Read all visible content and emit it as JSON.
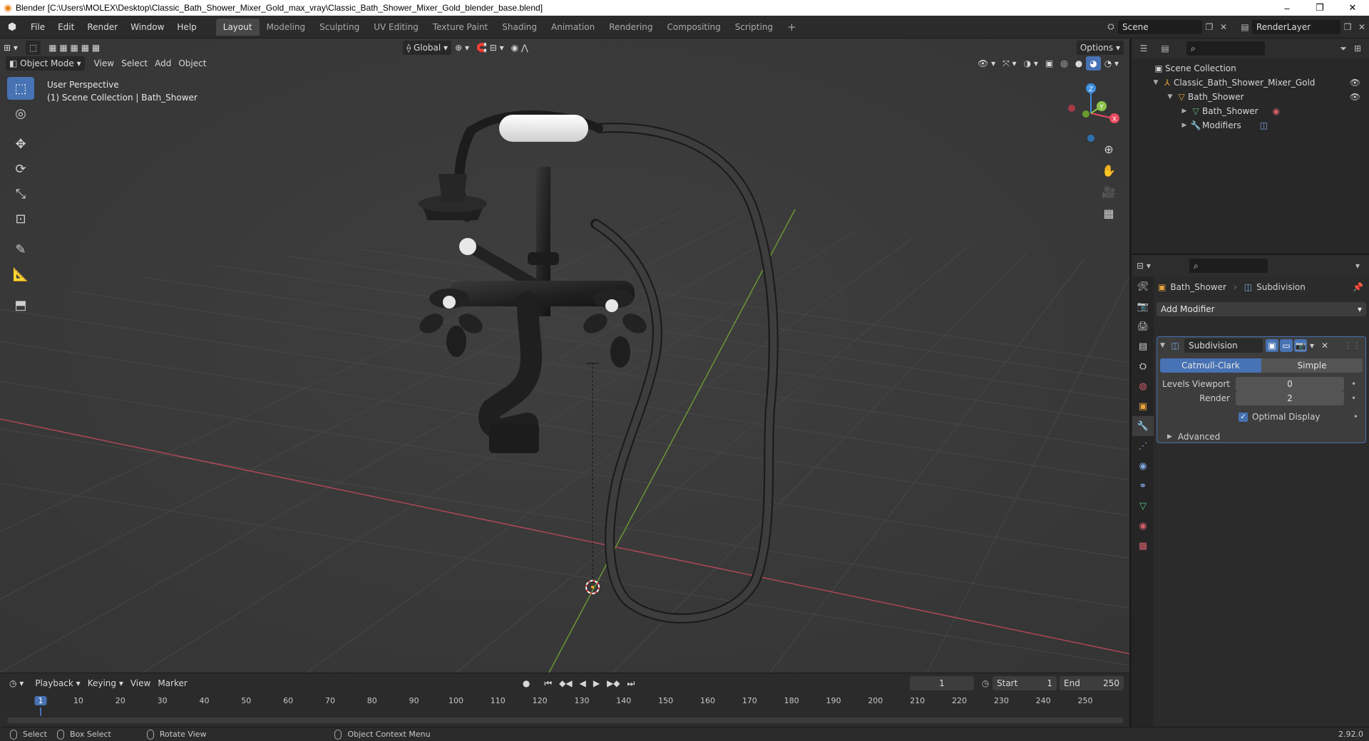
{
  "window": {
    "title": "Blender [C:\\Users\\MOLEX\\Desktop\\Classic_Bath_Shower_Mixer_Gold_max_vray\\Classic_Bath_Shower_Mixer_Gold_blender_base.blend]",
    "minimize": "–",
    "maximize": "❐",
    "close": "✕"
  },
  "menus": [
    "File",
    "Edit",
    "Render",
    "Window",
    "Help"
  ],
  "workspaces": [
    "Layout",
    "Modeling",
    "Sculpting",
    "UV Editing",
    "Texture Paint",
    "Shading",
    "Animation",
    "Rendering",
    "Compositing",
    "Scripting"
  ],
  "workspace_add": "+",
  "scene": {
    "name": "Scene",
    "view_layer": "RenderLayer"
  },
  "viewport": {
    "mode": "Object Mode",
    "menus": [
      "View",
      "Select",
      "Add",
      "Object"
    ],
    "transform_orientation": "Global",
    "options_label": "Options",
    "overlay_line1": "User Perspective",
    "overlay_line2": "(1) Scene Collection | Bath_Shower",
    "gizmo": {
      "x": "X",
      "y": "Y",
      "z": "Z"
    }
  },
  "timeline": {
    "menus": [
      "Playback",
      "Keying",
      "View",
      "Marker"
    ],
    "current_frame": "1",
    "start_label": "Start",
    "start": "1",
    "end_label": "End",
    "end": "250",
    "ruler_ticks": [
      "1",
      "10",
      "20",
      "30",
      "40",
      "50",
      "60",
      "70",
      "80",
      "90",
      "100",
      "110",
      "120",
      "130",
      "140",
      "150",
      "160",
      "170",
      "180",
      "190",
      "200",
      "210",
      "220",
      "230",
      "240",
      "250"
    ]
  },
  "statusbar": {
    "select": "Select",
    "box_select": "Box Select",
    "rotate_view": "Rotate View",
    "context_menu": "Object Context Menu",
    "version": "2.92.0"
  },
  "outliner": {
    "root": "Scene Collection",
    "collection": "Classic_Bath_Shower_Mixer_Gold",
    "object": "Bath_Shower",
    "mesh": "Bath_Shower",
    "modifiers": "Modifiers"
  },
  "properties": {
    "object_name": "Bath_Shower",
    "modifier_breadcrumb": "Subdivision",
    "add_modifier": "Add Modifier",
    "modifier": {
      "name": "Subdivision",
      "type_a": "Catmull-Clark",
      "type_b": "Simple",
      "levels_viewport_label": "Levels Viewport",
      "levels_viewport": "0",
      "render_label": "Render",
      "render": "2",
      "optimal_display_label": "Optimal Display",
      "optimal_display": true,
      "advanced_label": "Advanced"
    }
  },
  "colors": {
    "accent": "#4772b3",
    "x_axis": "#e84a5f",
    "y_axis": "#8bc34a",
    "z_axis": "#3d8fe0",
    "viewport_bg": "#3a3a3a"
  }
}
